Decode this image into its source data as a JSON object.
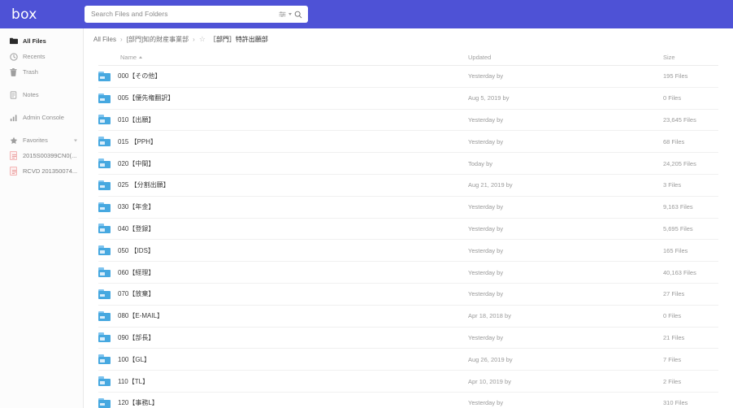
{
  "app": {
    "brand": "box"
  },
  "search": {
    "placeholder": "Search Files and Folders",
    "value": "",
    "filter_icon": "sliders-icon",
    "caret_icon": "chevron-down-icon",
    "search_icon": "search-icon"
  },
  "sidebar": {
    "items": [
      {
        "label": "All Files",
        "icon": "folder-icon",
        "active": true
      },
      {
        "label": "Recents",
        "icon": "clock-icon",
        "active": false
      },
      {
        "label": "Trash",
        "icon": "trash-icon",
        "active": false
      },
      {
        "label": "Notes",
        "icon": "notes-icon",
        "active": false
      },
      {
        "label": "Admin Console",
        "icon": "bar-chart-icon",
        "active": false
      },
      {
        "label": "Favorites",
        "icon": "star-icon",
        "active": false,
        "collapsible": true
      }
    ],
    "favorites": [
      {
        "label": "2015S00399CN0(...",
        "icon": "pdf-file-icon"
      },
      {
        "label": "RCVD 201350074...",
        "icon": "pdf-file-icon"
      }
    ]
  },
  "breadcrumb": {
    "root": "All Files",
    "separator": "›",
    "parent": "[部門]知的財産事業部",
    "star_icon": "star-outline-icon",
    "current": "［部門］特許出願部"
  },
  "table": {
    "headers": {
      "name": "Name",
      "updated": "Updated",
      "size": "Size"
    },
    "sort": {
      "column": "Name",
      "direction": "asc",
      "icon": "sort-asc-icon"
    },
    "rows": [
      {
        "name": "000【その他】",
        "updated": "Yesterday by",
        "size": "195 Files"
      },
      {
        "name": "005【優先権翻訳】",
        "updated": "Aug 5, 2019 by",
        "size": "0 Files"
      },
      {
        "name": "010【出願】",
        "updated": "Yesterday by",
        "size": "23,645 Files"
      },
      {
        "name": "015 【PPH】",
        "updated": "Yesterday by",
        "size": "68 Files"
      },
      {
        "name": "020【中間】",
        "updated": "Today by",
        "size": "24,205 Files"
      },
      {
        "name": "025 【分割出願】",
        "updated": "Aug 21, 2019 by",
        "size": "3 Files"
      },
      {
        "name": "030【年金】",
        "updated": "Yesterday by",
        "size": "9,163 Files"
      },
      {
        "name": "040【登録】",
        "updated": "Yesterday by",
        "size": "5,695 Files"
      },
      {
        "name": "050 【IDS】",
        "updated": "Yesterday by",
        "size": "165 Files"
      },
      {
        "name": "060【経理】",
        "updated": "Yesterday by",
        "size": "40,163 Files"
      },
      {
        "name": "070【放棄】",
        "updated": "Yesterday by",
        "size": "27 Files"
      },
      {
        "name": "080【E-MAIL】",
        "updated": "Apr 18, 2018 by",
        "size": "0 Files"
      },
      {
        "name": "090【部長】",
        "updated": "Yesterday by",
        "size": "21 Files"
      },
      {
        "name": "100【GL】",
        "updated": "Aug 26, 2019 by",
        "size": "7 Files"
      },
      {
        "name": "110【TL】",
        "updated": "Apr 10, 2019 by",
        "size": "2 Files"
      },
      {
        "name": "120【事務L】",
        "updated": "Yesterday by",
        "size": "310 Files"
      }
    ]
  },
  "colors": {
    "brand": "#4e52d6",
    "folder": "#46a8e0",
    "pdf": "#e8a0a0"
  }
}
